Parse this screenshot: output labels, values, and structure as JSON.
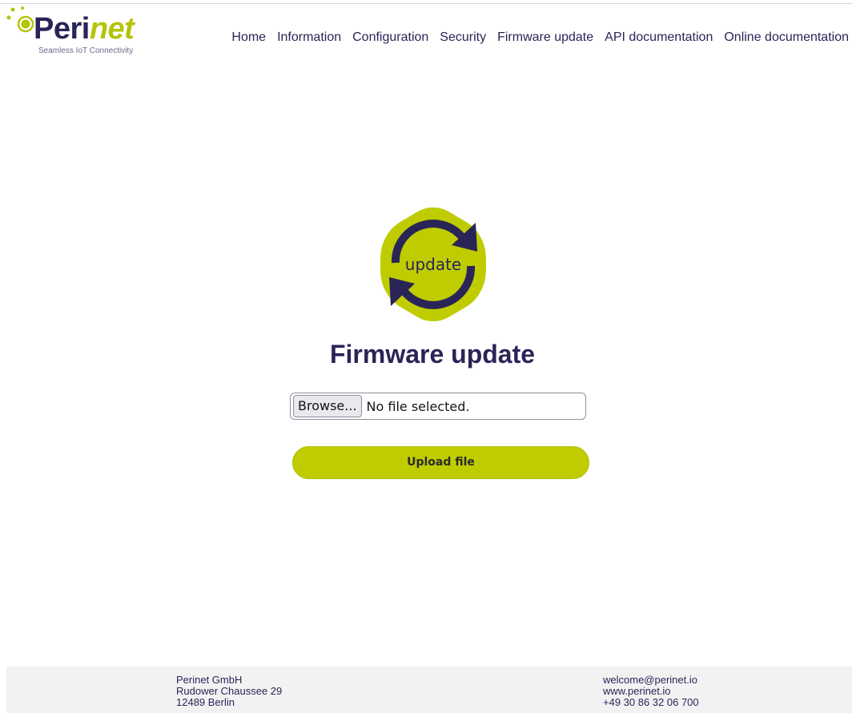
{
  "header": {
    "logo": {
      "word_part1": "Peri",
      "word_part2": "net",
      "tagline": "Seamless IoT Connectivity"
    },
    "nav": [
      {
        "label": "Home"
      },
      {
        "label": "Information"
      },
      {
        "label": "Configuration"
      },
      {
        "label": "Security"
      },
      {
        "label": "Firmware update"
      },
      {
        "label": "API documentation"
      },
      {
        "label": "Online documentation"
      }
    ]
  },
  "main": {
    "icon_label": "update",
    "title": "Firmware update",
    "file_input": {
      "button_label": "Browse...",
      "status": "No file selected."
    },
    "upload_label": "Upload file"
  },
  "footer": {
    "left": [
      "Perinet GmbH",
      "Rudower Chaussee 29",
      "12489 Berlin"
    ],
    "right": [
      "welcome@perinet.io",
      "www.perinet.io",
      "+49 30 86 32 06 700"
    ]
  },
  "colors": {
    "brand_navy": "#2a2557",
    "brand_lime": "#bfcc00"
  },
  "icons": {
    "logo_dots": "hexagon-dots-icon",
    "update": "refresh-arrows-icon"
  }
}
